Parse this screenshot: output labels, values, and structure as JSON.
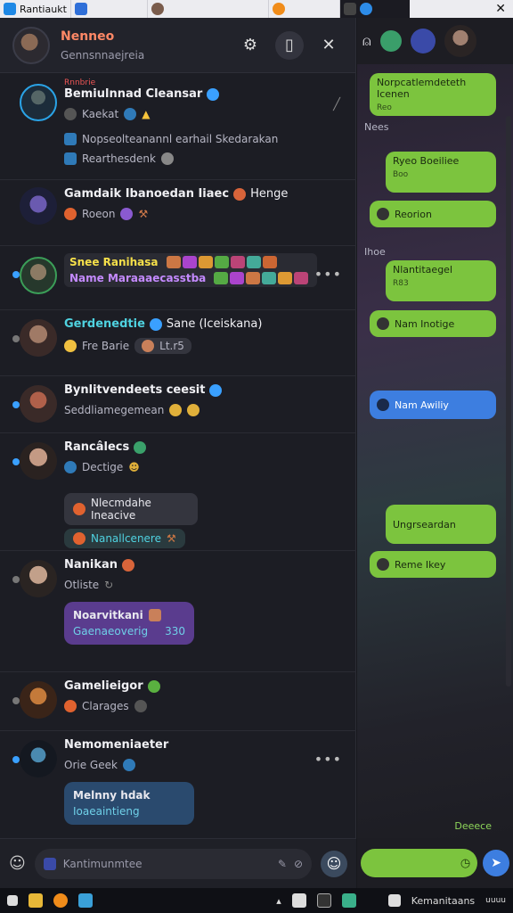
{
  "topbar": {
    "title": "Rantiaukt",
    "close_glyph": "✕"
  },
  "header": {
    "name": "Nenneo",
    "subtitle": "Gennsnnaejreia"
  },
  "chats": [
    {
      "tag": "Rnnbrie",
      "name": "Bemiulnnad Cleansar",
      "sub": "Kaekat",
      "line2": "Nopseolteanannl earhail Skedarakan",
      "line3": "Rearthesdenk"
    },
    {
      "name": "Gamdaik Ibanoedan Iiaec",
      "name_suffix": "Henge",
      "sub": "Roeon"
    },
    {
      "line1": "Snee Ranihasa",
      "line2": "Name Maraaaecasstba"
    },
    {
      "name": "Gerdenedtie",
      "name_suffix": "Sane (Iceiskana)",
      "sub": "Fre Barie",
      "sub2": "Lt.r5"
    },
    {
      "name": "Bynlitvendeets ceesit",
      "sub": "Seddliamegemean"
    },
    {
      "name": "Rancâlecs",
      "sub": "Dectige",
      "pill1": "Nlecmdahe Ineacive",
      "pill2": "Nanallcenere"
    },
    {
      "name": "Nanikan",
      "sub": "Otliste",
      "card_title": "Noarvitkani",
      "card_sub": "Gaenaeoverig",
      "card_num": "330"
    },
    {
      "name": "Gamelieigor",
      "sub": "Clarages"
    },
    {
      "name": "Nemomeniaeter",
      "sub": "Orie Geek",
      "card_title": "Melnny hdak",
      "card_sub": "Ioaeaintieng"
    }
  ],
  "composer": {
    "placeholder": "Kantimunmtee"
  },
  "right": {
    "labels": [
      "Nees",
      "Ihoe"
    ],
    "bubbles": [
      {
        "title": "Norpcatlemdeteth Icenen",
        "sub": "Reo"
      },
      {
        "title": "Ryeo Boeiliee",
        "sub": "Boo"
      },
      {
        "title": "Reorion"
      },
      {
        "title": "Nlantitaegel",
        "sub": "R83"
      },
      {
        "title": "Nam Inotige"
      },
      {
        "title": "Nam Awiliy"
      },
      {
        "title": "Ungrseardan"
      },
      {
        "title": "Reme Ikey"
      }
    ],
    "status": "Deeece"
  },
  "taskbar": {
    "label": "Kemanitaans",
    "right_text": "uuuu"
  },
  "colors": {
    "accent_green": "#7cc43e",
    "accent_blue": "#3d7ee0",
    "header_name": "#ff8866"
  }
}
